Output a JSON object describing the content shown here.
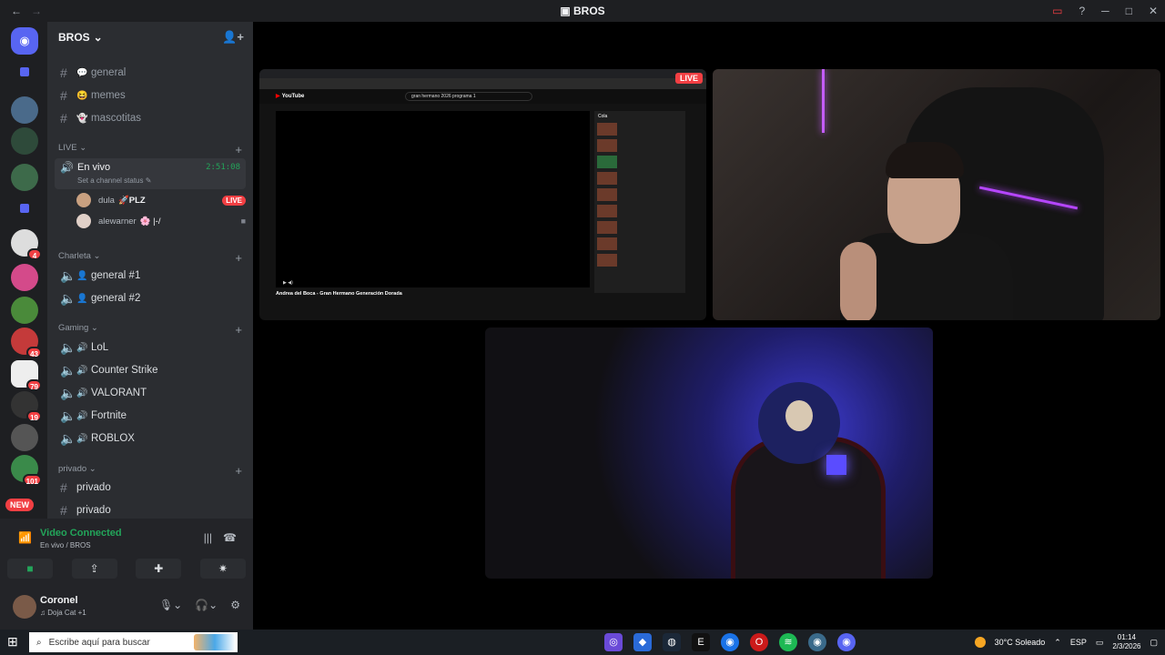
{
  "window": {
    "title": "BROS"
  },
  "server": {
    "name": "BROS"
  },
  "text_channels": [
    {
      "emoji": "💬",
      "label": "general"
    },
    {
      "emoji": "😆",
      "label": "memes"
    },
    {
      "emoji": "👻",
      "label": "mascotitas"
    }
  ],
  "categories": {
    "live": "LIVE",
    "charleta": "Charleta",
    "gaming": "Gaming",
    "privado": "privado"
  },
  "live_channel": {
    "name": "En vivo",
    "duration": "2:51:08",
    "status_placeholder": "Set a channel status"
  },
  "members": [
    {
      "name": "dula",
      "extra": "🚀PLZ",
      "badge": "LIVE"
    },
    {
      "name": "alewarner",
      "extra": "🌸 |-/"
    }
  ],
  "charleta_channels": [
    "general #1",
    "general #2"
  ],
  "gaming_channels": [
    "LoL",
    "Counter Strike",
    "VALORANT",
    "Fortnite",
    "ROBLOX"
  ],
  "privado_channels": [
    "privado",
    "privado"
  ],
  "server_badges": [
    "4",
    "43",
    "79",
    "19",
    "101"
  ],
  "server_new_label": "NEW",
  "voice": {
    "title": "Video Connected",
    "subtitle": "En vivo / BROS"
  },
  "user": {
    "name": "Coronel",
    "status": "Doja Cat +1"
  },
  "stage": {
    "live_tag": "LIVE",
    "yt_search": "gran hermano 2026 programa 1",
    "video_title": "Andrea del Boca - Gran Hermano Generación Dorada",
    "chat_title": "Cola"
  },
  "taskbar": {
    "search_placeholder": "Escribe aquí para buscar",
    "weather": "30°C Soleado",
    "lang": "ESP",
    "time": "01:14",
    "date": "2/3/2026"
  }
}
